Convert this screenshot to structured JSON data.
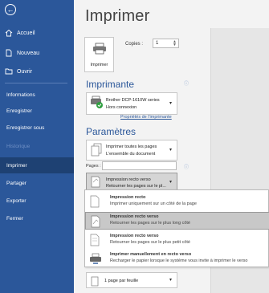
{
  "sidebar": {
    "back_glyph": "←",
    "items_top": [
      {
        "label": "Accueil",
        "icon": "home-icon"
      },
      {
        "label": "Nouveau",
        "icon": "new-document-icon"
      },
      {
        "label": "Ouvrir",
        "icon": "folder-icon"
      }
    ],
    "items": [
      {
        "label": "Informations"
      },
      {
        "label": "Enregistrer"
      },
      {
        "label": "Enregistrer sous"
      },
      {
        "label": "Historique"
      },
      {
        "label": "Imprimer"
      },
      {
        "label": "Partager"
      },
      {
        "label": "Exporter"
      },
      {
        "label": "Fermer"
      }
    ]
  },
  "main": {
    "title": "Imprimer",
    "print_button_label": "Imprimer",
    "copies_label": "Copies :",
    "copies_value": "1",
    "printer_section": "Imprimante",
    "printer_name": "Brother DCP-1610W series",
    "printer_status": "Hors connexion",
    "printer_properties_link": "Propriétés de l'imprimante",
    "settings_section": "Paramètres",
    "pages_setting_title": "Imprimer toutes les pages",
    "pages_setting_desc": "L'ensemble du document",
    "pages_label": "Pages :",
    "duplex_setting_title": "Impression recto verso",
    "duplex_setting_desc": "Retourner les pages sur le pl...",
    "per_sheet_label": "1 page par feuille"
  },
  "duplex_menu": [
    {
      "title": "Impression recto",
      "desc": "Imprimer uniquement sur un côté de la page"
    },
    {
      "title": "Impression recto verso",
      "desc": "Retourner les pages sur le plus long côté"
    },
    {
      "title": "Impression recto verso",
      "desc": "Retourner les pages sur le plus petit côté"
    },
    {
      "title": "Imprimer manuellement en recto verso",
      "desc": "Recharger le papier lorsque le système vous invite à imprimer le verso"
    }
  ],
  "colors": {
    "sidebar_bg": "#2b579a",
    "sidebar_active": "#1e4173",
    "accent": "#2b579a",
    "status_green": "#2e9e3f"
  }
}
